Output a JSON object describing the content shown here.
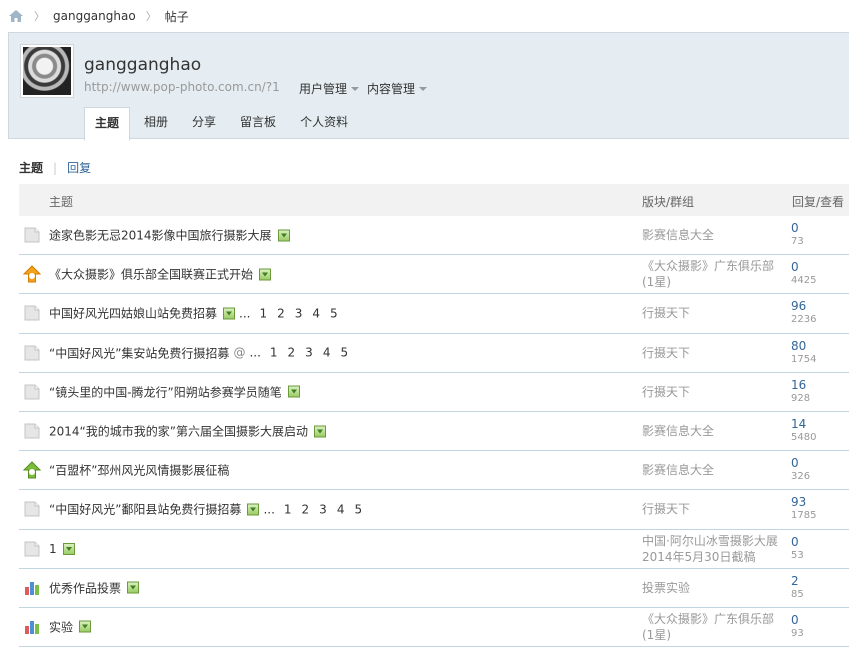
{
  "breadcrumb": {
    "user": "gangganghao",
    "current": "帖子"
  },
  "profile": {
    "username": "gangganghao",
    "url": "http://www.pop-photo.com.cn/?1",
    "menu_user": "用户管理",
    "menu_content": "内容管理",
    "tabs": [
      "主题",
      "相册",
      "分享",
      "留言板",
      "个人资料"
    ]
  },
  "subtabs": {
    "active": "主题",
    "other": "回复"
  },
  "table": {
    "headers": {
      "title": "主题",
      "forum": "版块/群组",
      "counts": "回复/查看"
    },
    "rows": [
      {
        "icon": "doc-icon",
        "title": "途家色影无忌2014影像中国旅行摄影大展",
        "has_image": true,
        "forum": "影赛信息大全",
        "replies": "0",
        "views": "73"
      },
      {
        "icon": "orange-upgrade-icon",
        "title": "《大众摄影》俱乐部全国联赛正式开始",
        "has_image": true,
        "forum": "《大众摄影》广东俱乐部(1星)",
        "replies": "0",
        "views": "4425"
      },
      {
        "icon": "doc-icon",
        "title": "中国好风光四姑娘山站免费招募",
        "has_image": true,
        "ellipsis": "...",
        "pages": [
          "1",
          "2",
          "3",
          "4",
          "5"
        ],
        "forum": "行摄天下",
        "replies": "96",
        "views": "2236"
      },
      {
        "icon": "doc-icon",
        "title": "“中国好风光”集安站免费行摄招募",
        "has_attachment": true,
        "ellipsis": "...",
        "pages": [
          "1",
          "2",
          "3",
          "4",
          "5"
        ],
        "forum": "行摄天下",
        "replies": "80",
        "views": "1754"
      },
      {
        "icon": "doc-icon",
        "title": "“镜头里的中国-腾龙行”阳朔站参赛学员随笔",
        "has_image": true,
        "forum": "行摄天下",
        "replies": "16",
        "views": "928"
      },
      {
        "icon": "doc-icon",
        "title": "2014“我的城市我的家”第六届全国摄影大展启动",
        "has_image": true,
        "forum": "影赛信息大全",
        "replies": "14",
        "views": "5480"
      },
      {
        "icon": "green-upgrade-icon",
        "title": "“百盟杯”邳州风光风情摄影展征稿",
        "forum": "影赛信息大全",
        "replies": "0",
        "views": "326"
      },
      {
        "icon": "doc-icon",
        "title": "“中国好风光”鄱阳县站免费行摄招募",
        "has_image": true,
        "ellipsis": "...",
        "pages": [
          "1",
          "2",
          "3",
          "4",
          "5"
        ],
        "forum": "行摄天下",
        "replies": "93",
        "views": "1785"
      },
      {
        "icon": "doc-icon",
        "title": "1",
        "has_image": true,
        "forum": "中国·阿尔山冰雪摄影大展2014年5月30日截稿",
        "replies": "0",
        "views": "53"
      },
      {
        "icon": "poll-icon",
        "title": "优秀作品投票",
        "has_image": true,
        "forum": "投票实验",
        "replies": "2",
        "views": "85"
      },
      {
        "icon": "poll-icon",
        "title": "实验",
        "has_image": true,
        "forum": "《大众摄影》广东俱乐部(1星)",
        "replies": "0",
        "views": "93"
      }
    ]
  },
  "colors": {
    "header_bg": "#e5edf2",
    "link": "#336699",
    "row_border": "#c2d5e3",
    "muted": "#999999"
  }
}
